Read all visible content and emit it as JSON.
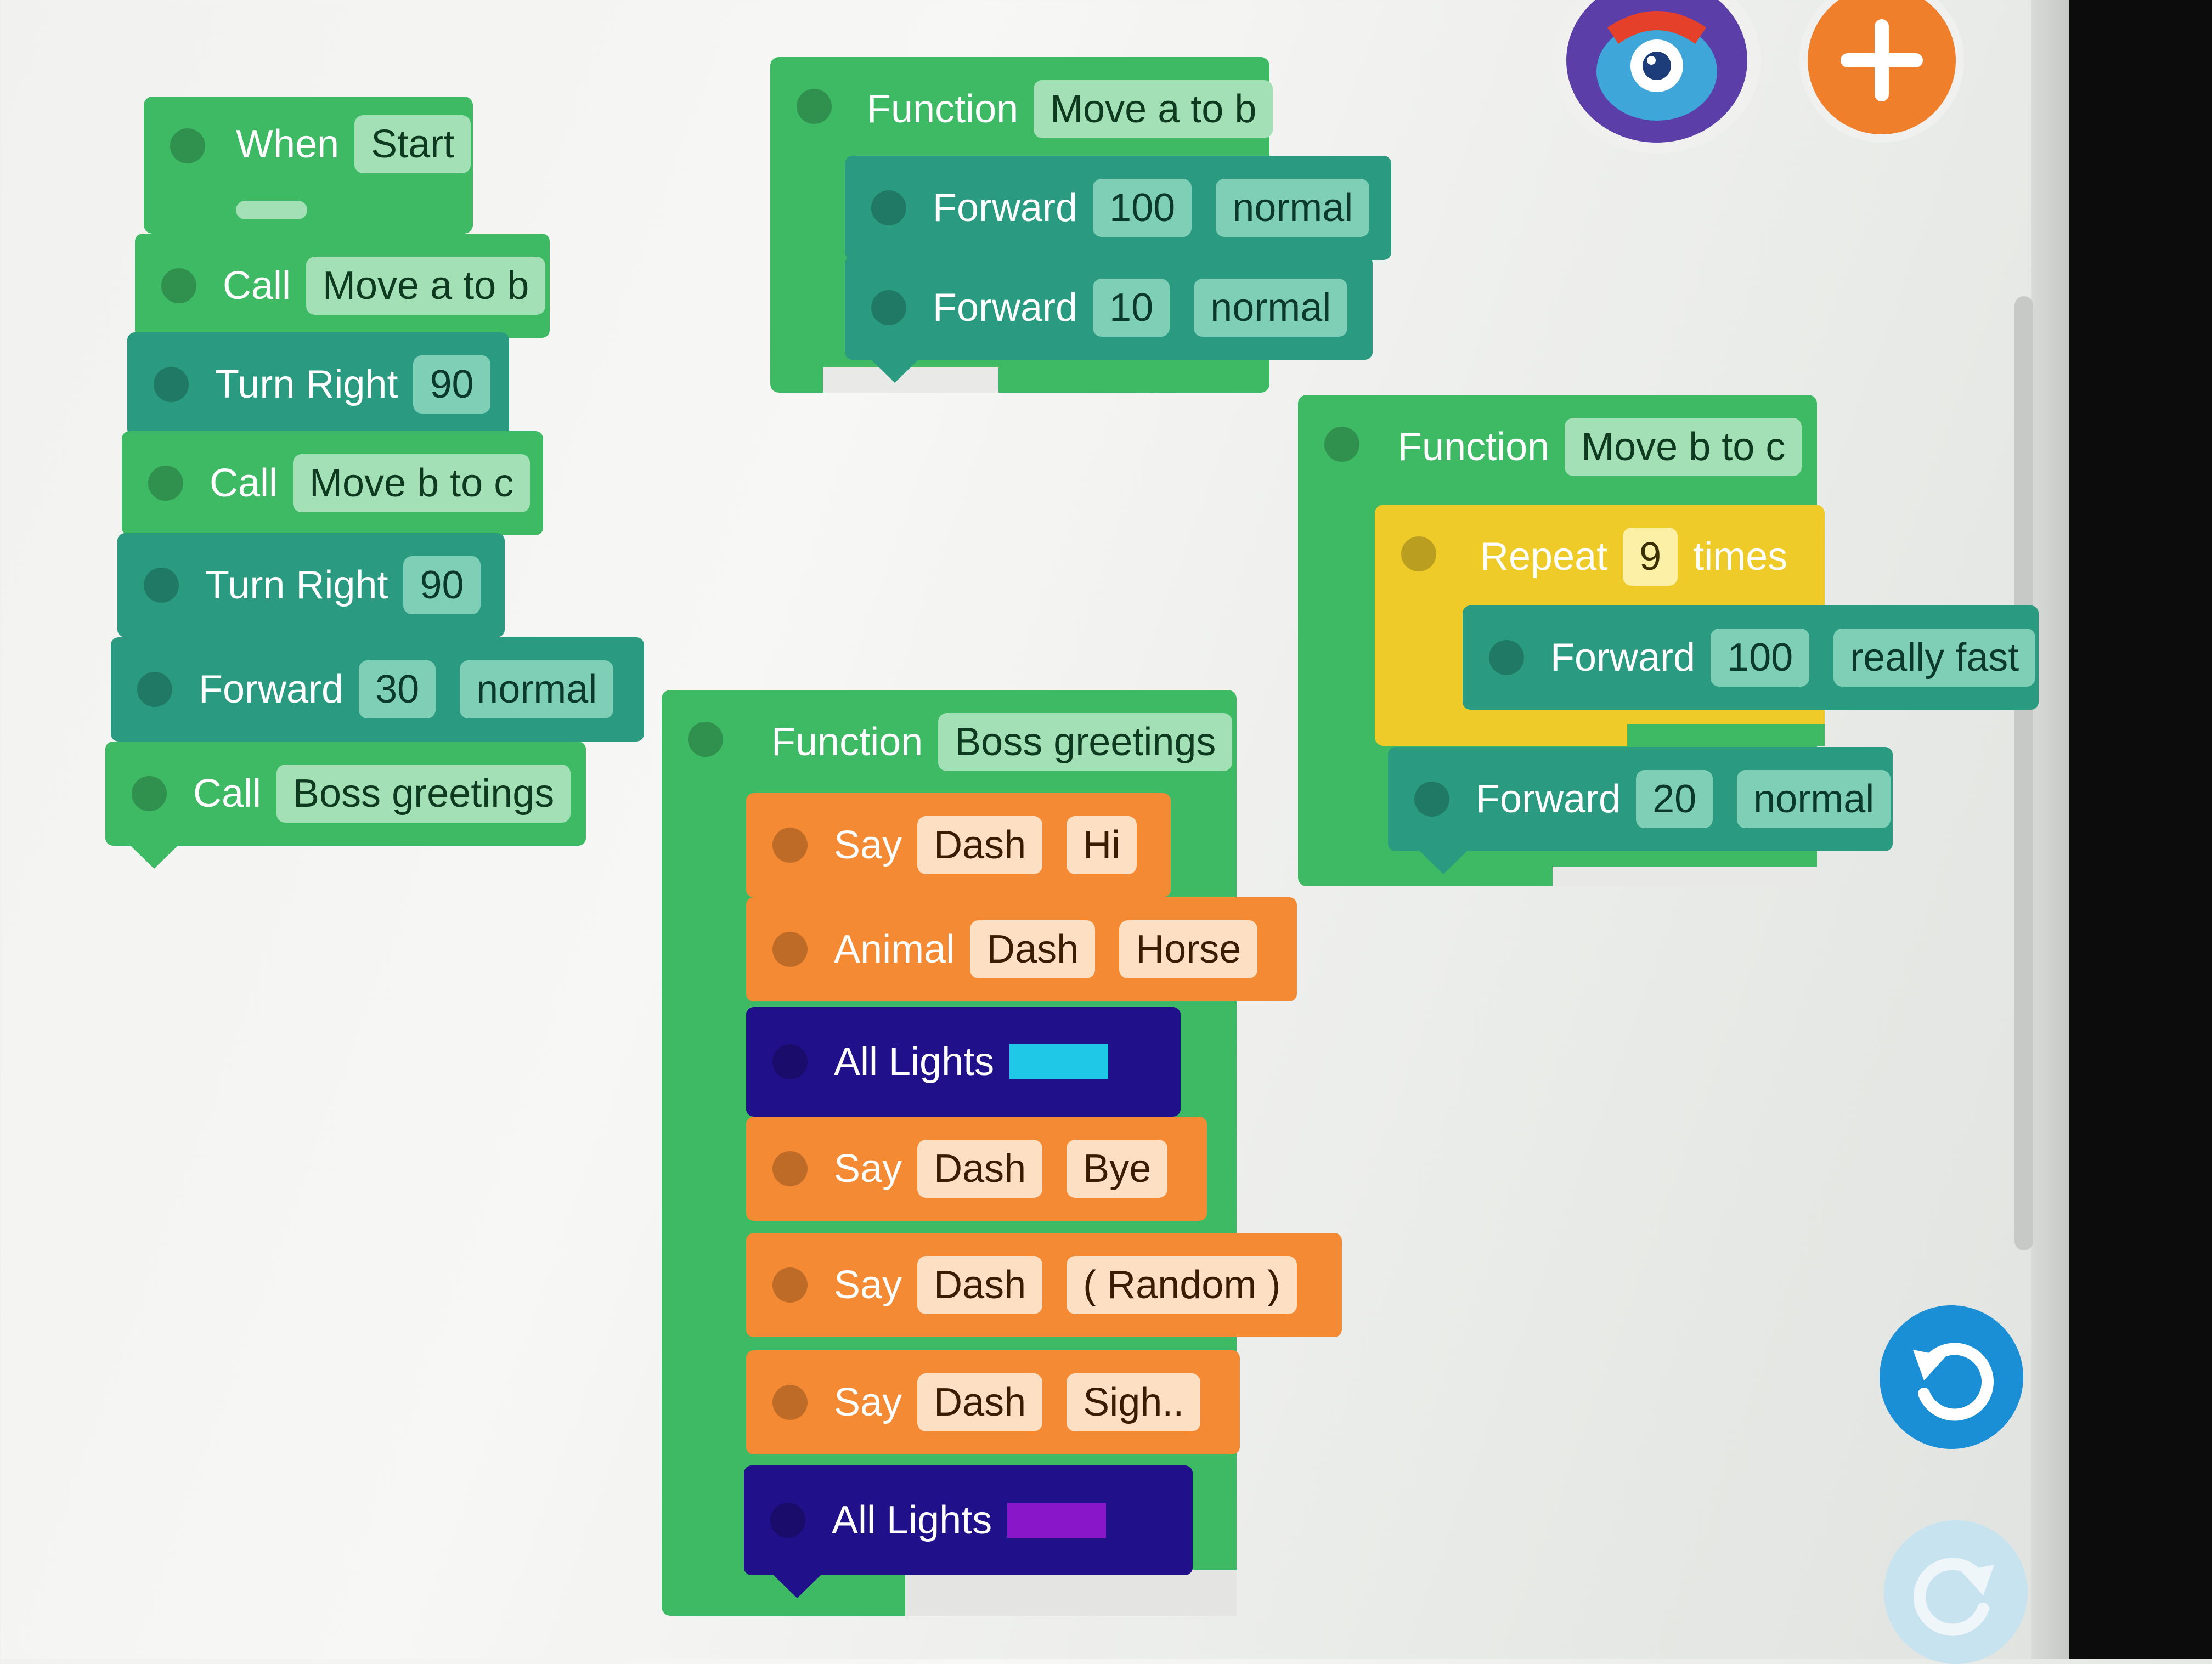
{
  "colors": {
    "block_green": "#3dba63",
    "block_teal": "#2a9b80",
    "block_orange": "#f58a34",
    "block_navy": "#20108a",
    "block_yellow": "#efcb2a",
    "light_cyan": "#1ec8e6",
    "light_purple": "#8a16c9",
    "add_button": "#f07f2c",
    "undo_button": "#1b8fd6"
  },
  "toolbar": {
    "avatar_icon": "monster-avatar-icon",
    "add_icon": "plus-icon",
    "undo_icon": "undo-icon",
    "redo_icon": "redo-icon"
  },
  "main": {
    "when_label": "When",
    "when_value": "Start",
    "steps": [
      {
        "keyword": "Call",
        "params": [
          "Move a to b"
        ]
      },
      {
        "keyword": "Turn Right",
        "params": [
          "90"
        ]
      },
      {
        "keyword": "Call",
        "params": [
          "Move b to c"
        ]
      },
      {
        "keyword": "Turn Right",
        "params": [
          "90"
        ]
      },
      {
        "keyword": "Forward",
        "params": [
          "30",
          "normal"
        ]
      },
      {
        "keyword": "Call",
        "params": [
          "Boss greetings"
        ]
      }
    ]
  },
  "func_ab": {
    "label": "Function",
    "name": "Move a to b",
    "steps": [
      {
        "keyword": "Forward",
        "params": [
          "100",
          "normal"
        ]
      },
      {
        "keyword": "Forward",
        "params": [
          "10",
          "normal"
        ]
      }
    ]
  },
  "func_bc": {
    "label": "Function",
    "name": "Move b to c",
    "repeat": {
      "keyword": "Repeat",
      "count": "9",
      "suffix": "times"
    },
    "repeat_body": {
      "keyword": "Forward",
      "params": [
        "100",
        "really fast"
      ]
    },
    "after": {
      "keyword": "Forward",
      "params": [
        "20",
        "normal"
      ]
    }
  },
  "func_boss": {
    "label": "Function",
    "name": "Boss greetings",
    "steps": [
      {
        "keyword": "Say",
        "params": [
          "Dash",
          "Hi"
        ]
      },
      {
        "keyword": "Animal",
        "params": [
          "Dash",
          "Horse"
        ]
      },
      {
        "keyword": "All Lights",
        "color": "#1ec8e6"
      },
      {
        "keyword": "Say",
        "params": [
          "Dash",
          "Bye"
        ]
      },
      {
        "keyword": "Say",
        "params": [
          "Dash",
          "( Random )"
        ]
      },
      {
        "keyword": "Say",
        "params": [
          "Dash",
          "Sigh.."
        ]
      },
      {
        "keyword": "All Lights",
        "color": "#8a16c9"
      }
    ]
  }
}
